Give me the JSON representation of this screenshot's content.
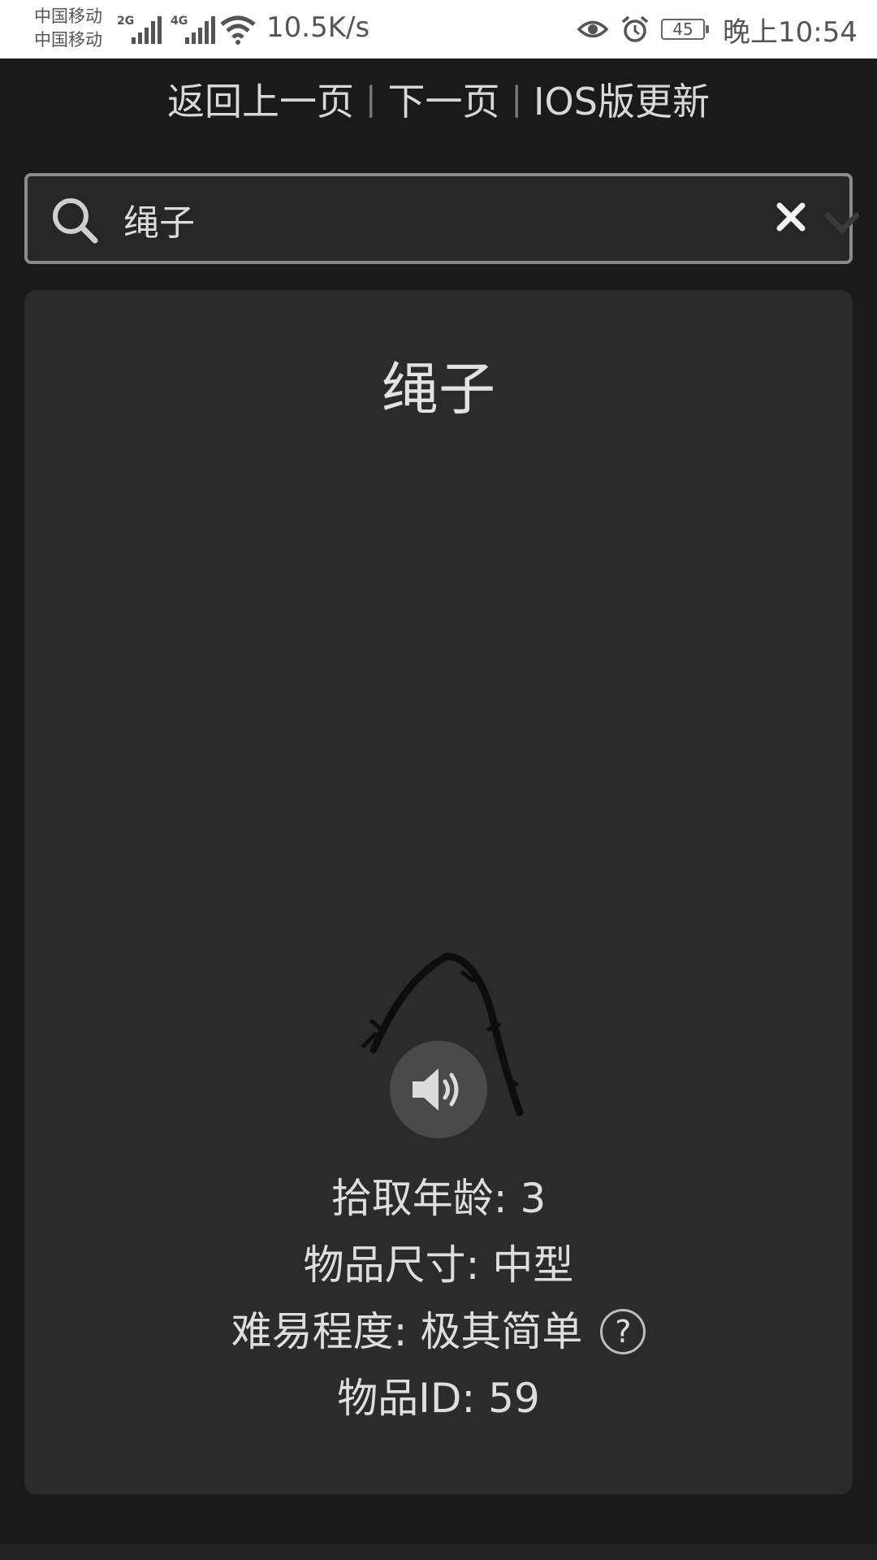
{
  "status_bar": {
    "carrier_1": "中国移动",
    "carrier_2": "中国移动",
    "net_1": "2G",
    "net_2": "4G",
    "net_speed": "10.5K/s",
    "battery": "45",
    "time": "晚上10:54"
  },
  "nav": {
    "back": "返回上一页",
    "next": "下一页",
    "ios_update": "IOS版更新",
    "separator": "|"
  },
  "search": {
    "value": "绳子"
  },
  "item": {
    "title": "绳子",
    "age_label": "拾取年龄: 3",
    "size_label": "物品尺寸: 中型",
    "difficulty_label": "难易程度: 极其简单",
    "id_label": "物品ID: 59",
    "help_glyph": "?"
  },
  "colors": {
    "background": "#1a1a1a",
    "card": "#2b2b2b",
    "text": "#dedede",
    "search_border": "#8a8a8a"
  }
}
